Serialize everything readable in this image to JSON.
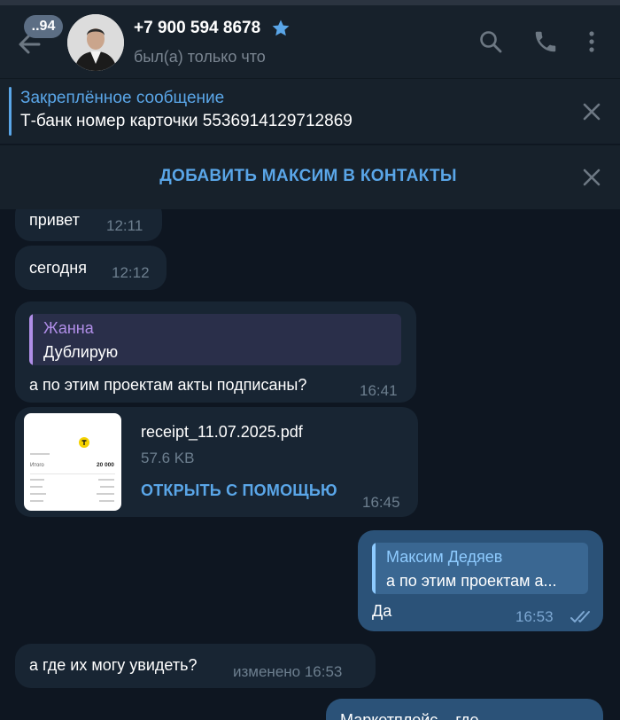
{
  "header": {
    "unread_count": "..94",
    "contact_name": "+7 900 594 8678",
    "status": "был(а) только что"
  },
  "pinned": {
    "title": "Закреплённое сообщение",
    "text": "Т-банк номер карточки 5536914129712869"
  },
  "add_contact": {
    "label": "ДОБАВИТЬ МАКСИМ В КОНТАКТЫ"
  },
  "messages": [
    {
      "text": "привет",
      "time": "12:11"
    },
    {
      "text": "сегодня",
      "time": "12:12"
    },
    {
      "reply_author": "Жанна",
      "reply_text": "Дублирую",
      "text": "а по этим проектам акты подписаны?",
      "time": "16:41"
    },
    {
      "file_name": "receipt_11.07.2025.pdf",
      "file_size": "57.6 KB",
      "action": "ОТКРЫТЬ С ПОМОЩЬЮ",
      "time": "16:45",
      "thumb_label": "Итого",
      "thumb_amount": "20 000"
    },
    {
      "reply_author": "Максим Дедяев",
      "reply_text": "а по этим проектам а...",
      "text": "Да",
      "time": "16:53"
    },
    {
      "text": "а где их могу увидеть?",
      "time": "изменено 16:53"
    },
    {
      "text": "Маркетплейс – где"
    }
  ],
  "colors": {
    "background": "#0e1621",
    "header": "#17212b",
    "incoming_bubble": "#182533",
    "outgoing_bubble": "#2b5278",
    "accent": "#5aa6e8",
    "reply_accent_incoming": "#b08ee8"
  }
}
